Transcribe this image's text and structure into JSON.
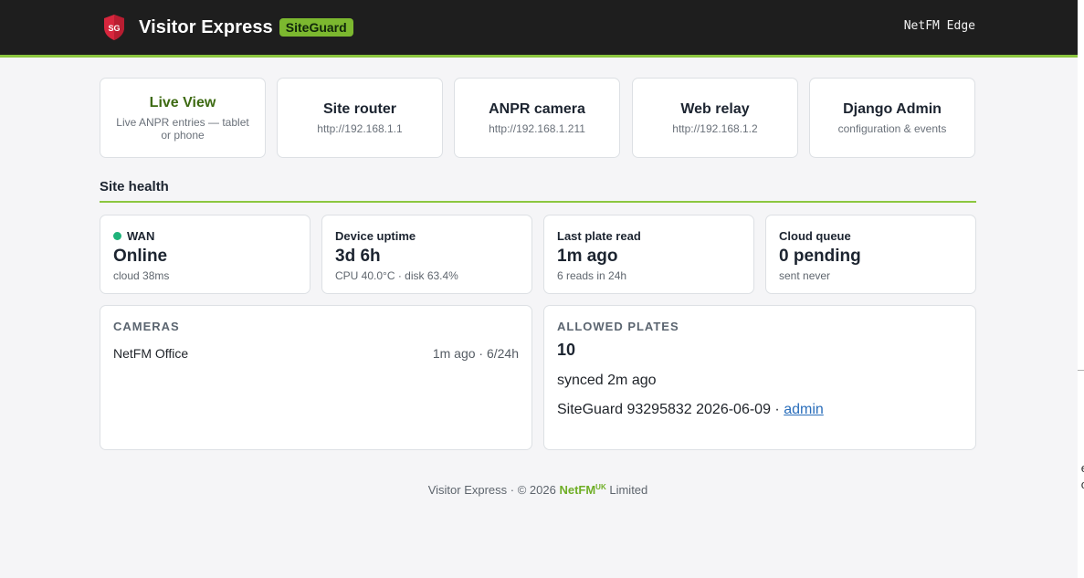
{
  "header": {
    "logo_text": "SG",
    "app_name": "Visitor Express",
    "badge": "SiteGuard",
    "edge_label": "NetFM Edge"
  },
  "quick_links": [
    {
      "title": "Live View",
      "subtitle": "Live ANPR entries — tablet or phone"
    },
    {
      "title": "Site router",
      "subtitle": "http://192.168.1.1"
    },
    {
      "title": "ANPR camera",
      "subtitle": "http://192.168.1.211"
    },
    {
      "title": "Web relay",
      "subtitle": "http://192.168.1.2"
    },
    {
      "title": "Django Admin",
      "subtitle": "configuration & events"
    }
  ],
  "site_health": {
    "title": "Site health",
    "cards": [
      {
        "label": "WAN",
        "value": "Online",
        "sub": "cloud 38ms",
        "status_color": "#1fb37a"
      },
      {
        "label": "Device uptime",
        "value": "3d 6h",
        "sub": "CPU 40.0°C · disk 63.4%"
      },
      {
        "label": "Last plate read",
        "value": "1m ago",
        "sub": "6 reads in 24h"
      },
      {
        "label": "Cloud queue",
        "value": "0 pending",
        "sub": "sent never"
      }
    ]
  },
  "cameras": {
    "title": "CAMERAS",
    "items": [
      {
        "name": "NetFM Office",
        "meta": "1m ago · 6/24h"
      }
    ]
  },
  "allowed_plates": {
    "title": "ALLOWED PLATES",
    "count": "10",
    "synced": "synced 2m ago",
    "footer_prefix": "SiteGuard 93295832 2026-06-09 ·",
    "admin_link": "admin"
  },
  "footer": {
    "prefix": "Visitor Express · © 2026",
    "brand": "NetFM",
    "brand_sup": "UK",
    "suffix": "Limited"
  },
  "scroll_rail": {
    "glyph_1": "e",
    "glyph_2": "o"
  },
  "colors": {
    "accent": "#8cc63f",
    "topbar": "#1e1e1e",
    "shield": "#d7263d",
    "link": "#2a6ebb"
  }
}
